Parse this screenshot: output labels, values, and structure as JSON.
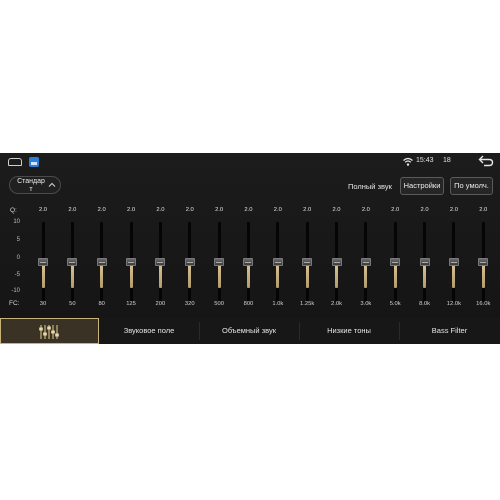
{
  "status_bar": {
    "time": "15:43",
    "volume": "18",
    "icons": [
      "home-icon",
      "app-icon",
      "wifi-icon",
      "back-icon"
    ]
  },
  "header": {
    "preset": "Стандар\nт",
    "full_sound_label": "Полный звук",
    "settings_button": "Настройки",
    "default_button": "По умолч."
  },
  "equalizer": {
    "q_label": "Q:",
    "fc_label": "FC:",
    "scale": [
      "10",
      "5",
      "0",
      "-5",
      "-10"
    ],
    "bands": [
      {
        "fc": "30",
        "q": "2.0",
        "gain": 0
      },
      {
        "fc": "50",
        "q": "2.0",
        "gain": 0
      },
      {
        "fc": "80",
        "q": "2.0",
        "gain": 0
      },
      {
        "fc": "125",
        "q": "2.0",
        "gain": 0
      },
      {
        "fc": "200",
        "q": "2.0",
        "gain": 0
      },
      {
        "fc": "320",
        "q": "2.0",
        "gain": 0
      },
      {
        "fc": "500",
        "q": "2.0",
        "gain": 0
      },
      {
        "fc": "800",
        "q": "2.0",
        "gain": 0
      },
      {
        "fc": "1.0k",
        "q": "2.0",
        "gain": 0
      },
      {
        "fc": "1.25k",
        "q": "2.0",
        "gain": 0
      },
      {
        "fc": "2.0k",
        "q": "2.0",
        "gain": 0
      },
      {
        "fc": "3.0k",
        "q": "2.0",
        "gain": 0
      },
      {
        "fc": "5.0k",
        "q": "2.0",
        "gain": 0
      },
      {
        "fc": "8.0k",
        "q": "2.0",
        "gain": 0
      },
      {
        "fc": "12.0k",
        "q": "2.0",
        "gain": 0
      },
      {
        "fc": "16.0k",
        "q": "2.0",
        "gain": 0
      }
    ]
  },
  "tabs": [
    {
      "label": "",
      "icon": "equalizer-icon",
      "active": true
    },
    {
      "label": "Звуковое поле",
      "active": false
    },
    {
      "label": "Объемный звук",
      "active": false
    },
    {
      "label": "Низкие тоны",
      "active": false
    },
    {
      "label": "Bass Filter",
      "active": false
    }
  ],
  "colors": {
    "accent": "#c9b37d",
    "slider_fill": "#d9c79a",
    "background": "#1c1c1c"
  }
}
